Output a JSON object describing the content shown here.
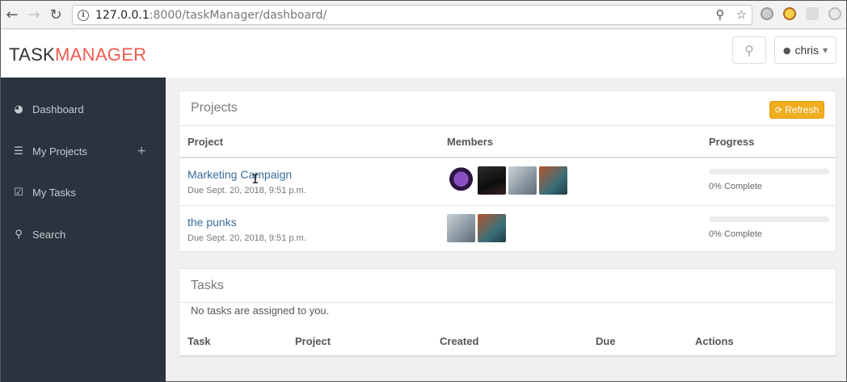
{
  "browser": {
    "url_host": "127.0.0.1",
    "url_rest": ":8000/taskManager/dashboard/",
    "icons": [
      "back-icon",
      "forward-icon",
      "reload-icon",
      "info-icon",
      "key-icon",
      "star-icon"
    ]
  },
  "header": {
    "logo_part1": "TASK",
    "logo_part2": "MANAGER",
    "username": "chris"
  },
  "sidebar": {
    "items": [
      {
        "label": "Dashboard",
        "icon": "dashboard-icon"
      },
      {
        "label": "My Projects",
        "icon": "list-icon",
        "action": "+"
      },
      {
        "label": "My Tasks",
        "icon": "checkbox-icon"
      },
      {
        "label": "Search",
        "icon": "search-icon"
      }
    ]
  },
  "projects": {
    "title": "Projects",
    "refresh_label": "Refresh",
    "columns": [
      "Project",
      "Members",
      "Progress"
    ],
    "rows": [
      {
        "name": "Marketing Campaign",
        "due": "Due Sept. 20, 2018, 9:51 p.m.",
        "progress": 0,
        "progress_label": "0% Complete"
      },
      {
        "name": "the punks",
        "due": "Due Sept. 20, 2018, 9:51 p.m.",
        "progress": 0,
        "progress_label": "0% Complete"
      }
    ]
  },
  "tasks": {
    "title": "Tasks",
    "empty_message": "No tasks are assigned to you.",
    "columns": [
      "Task",
      "Project",
      "Created",
      "Due",
      "Actions"
    ]
  },
  "colors": {
    "accent": "#f05a4f",
    "sidebar_bg": "#2b333e",
    "refresh_bg": "#f0ad1e",
    "link": "#3a6d99"
  }
}
